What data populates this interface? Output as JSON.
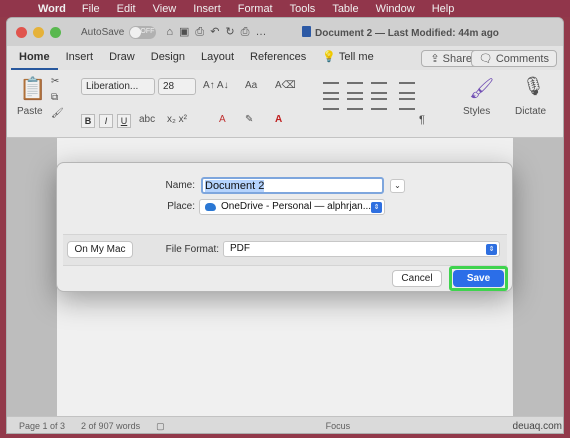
{
  "menubar": {
    "app": "Word",
    "items": [
      "File",
      "Edit",
      "View",
      "Insert",
      "Format",
      "Tools",
      "Table",
      "Window",
      "Help"
    ]
  },
  "titlebar": {
    "autosave": "AutoSave",
    "autosave_state": "OFF",
    "title": "Document 2 — Last Modified: 44m ago"
  },
  "ribbon": {
    "tabs": [
      "Home",
      "Insert",
      "Draw",
      "Design",
      "Layout",
      "References"
    ],
    "tell_me": "Tell me",
    "share": "Share",
    "comments": "Comments",
    "paste": "Paste",
    "font": "Liberation...",
    "font_size": "28",
    "styles": "Styles",
    "dictate": "Dictate"
  },
  "dialog": {
    "name_label": "Name:",
    "name_value": "Document 2",
    "place_label": "Place:",
    "place_value": "OneDrive - Personal — alphrjan...",
    "on_my_mac": "On My Mac",
    "format_label": "File Format:",
    "format_value": "PDF",
    "cancel": "Cancel",
    "save": "Save"
  },
  "status": {
    "page": "Page 1 of 3",
    "words": "2 of 907 words",
    "focus": "Focus"
  },
  "watermark": "deuaq.com",
  "accent": "#2b6ee8",
  "highlight": "#3fd34e"
}
